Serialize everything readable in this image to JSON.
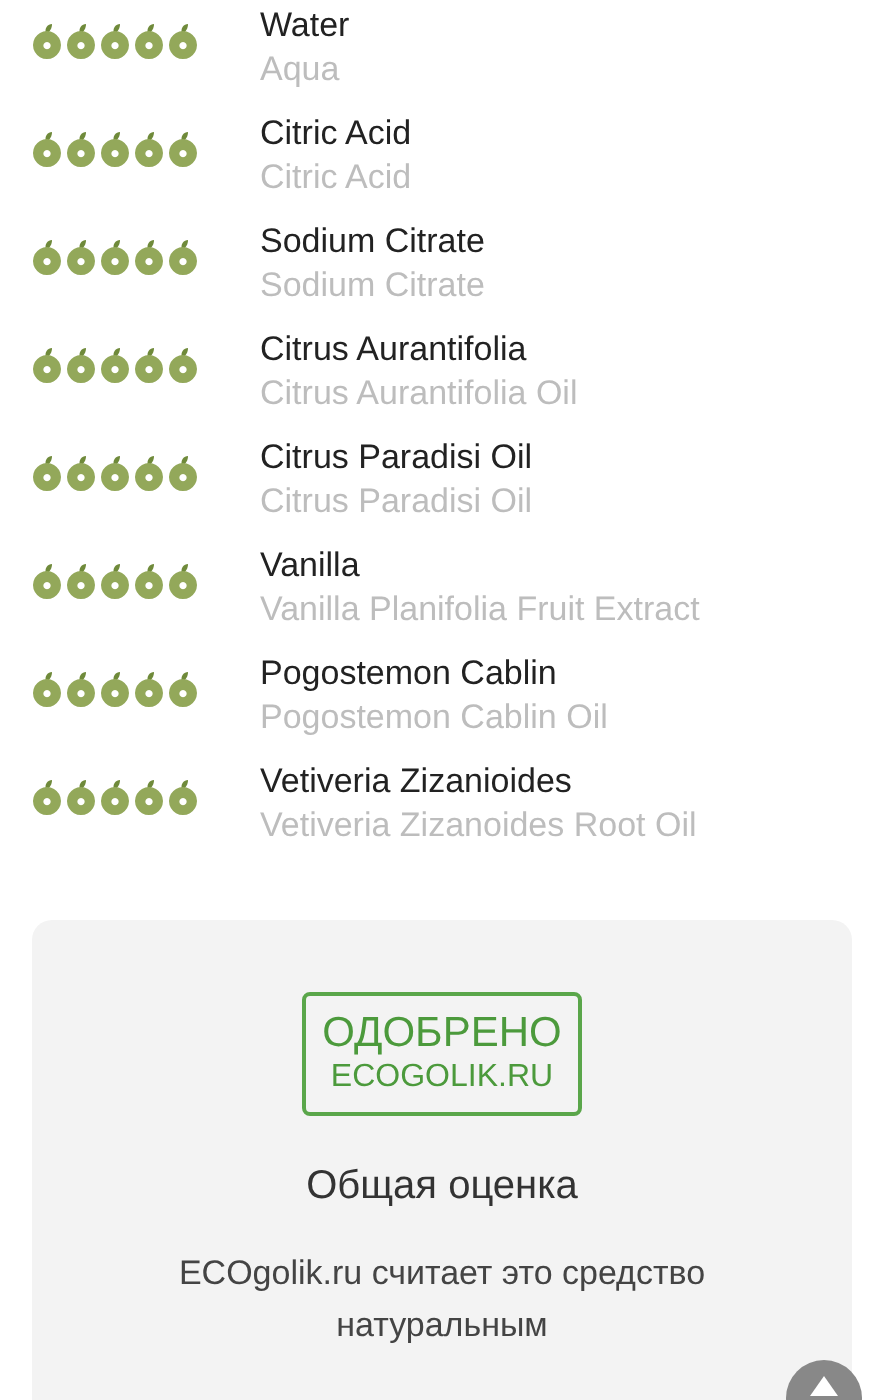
{
  "ingredients": [
    {
      "name": "Water",
      "inci": "Aqua",
      "stars": 5
    },
    {
      "name": "Citric Acid",
      "inci": "Citric Acid",
      "stars": 5
    },
    {
      "name": "Sodium Citrate",
      "inci": "Sodium Citrate",
      "stars": 5
    },
    {
      "name": "Citrus Aurantifolia",
      "inci": "Citrus Aurantifolia Oil",
      "stars": 5
    },
    {
      "name": "Citrus Paradisi Oil",
      "inci": "Citrus Paradisi Oil",
      "stars": 5
    },
    {
      "name": "Vanilla",
      "inci": "Vanilla Planifolia Fruit Extract",
      "stars": 5
    },
    {
      "name": "Pogostemon Cablin",
      "inci": "Pogostemon Cablin Oil",
      "stars": 5
    },
    {
      "name": "Vetiveria Zizanioides",
      "inci": "Vetiveria Zizanoides Root Oil",
      "stars": 5
    }
  ],
  "verdict": {
    "stamp_lines": [
      "ОДОБРЕНО",
      "ECOGOLIK.RU"
    ],
    "title": "Общая оценка",
    "text": "ECOgolik.ru считает это средство натуральным"
  }
}
